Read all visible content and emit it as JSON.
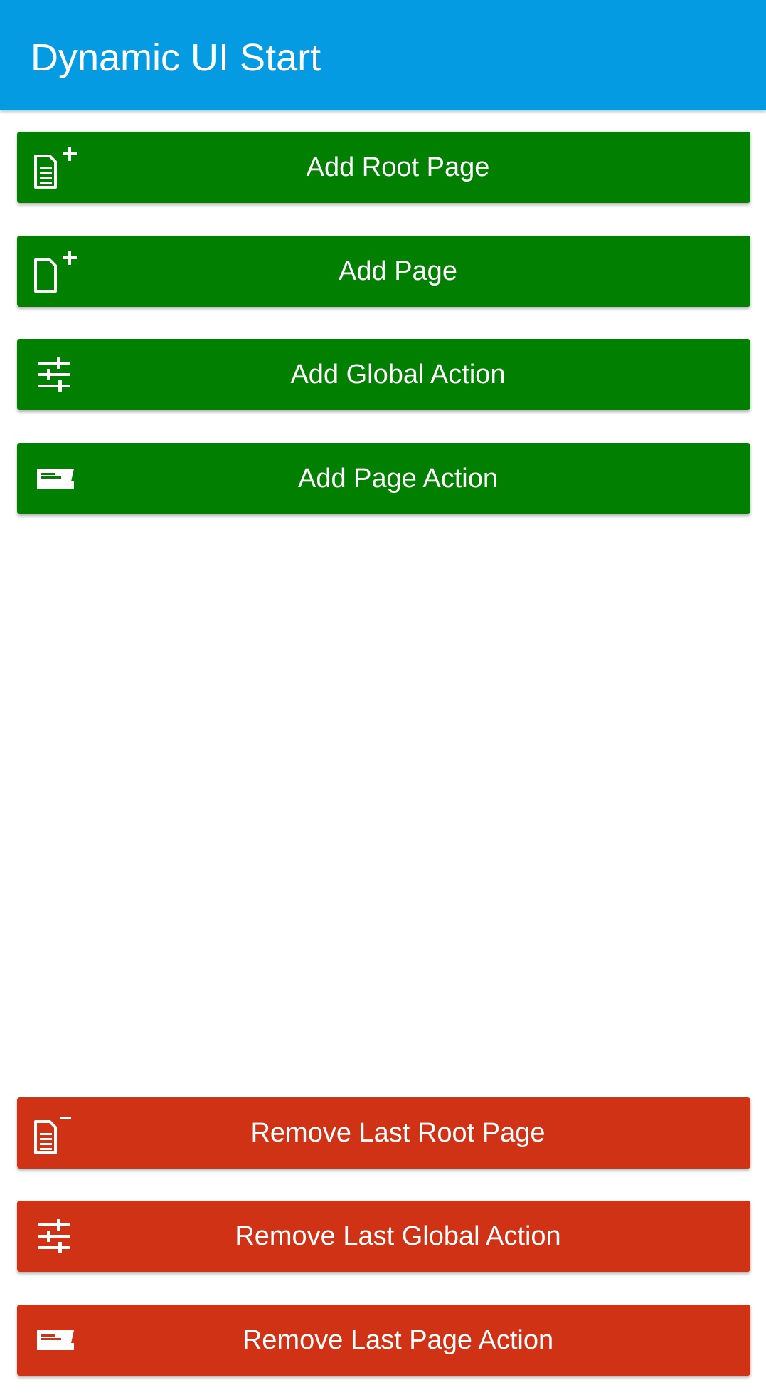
{
  "appbar": {
    "title": "Dynamic UI Start",
    "color": "#049be3"
  },
  "colors": {
    "add": "#017f01",
    "remove": "#d03216",
    "text": "#ffffff"
  },
  "add_buttons": [
    {
      "label": "Add Root Page",
      "icon": "add-root-page-icon"
    },
    {
      "label": "Add Page",
      "icon": "add-page-icon"
    },
    {
      "label": "Add Global Action",
      "icon": "sliders-icon"
    },
    {
      "label": "Add Page Action",
      "icon": "page-action-icon"
    }
  ],
  "remove_buttons": [
    {
      "label": "Remove Last Root Page",
      "icon": "remove-root-page-icon"
    },
    {
      "label": "Remove Last Global Action",
      "icon": "sliders-icon"
    },
    {
      "label": "Remove Last Page Action",
      "icon": "page-action-icon"
    }
  ]
}
